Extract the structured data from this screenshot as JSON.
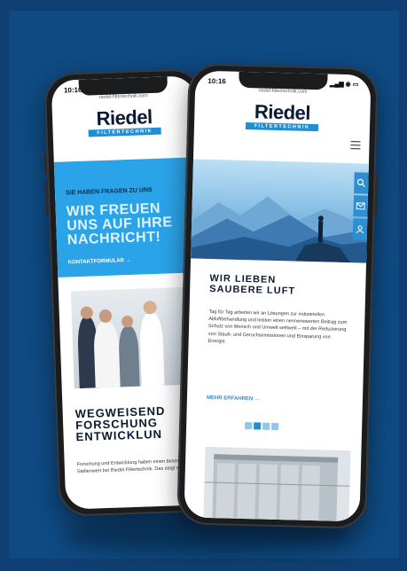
{
  "back_phone": {
    "time": "10:16",
    "url": "riedel-filtertechnik.com",
    "logo": {
      "word": "Riedel",
      "tagline": "FILTERTECHNIK"
    },
    "hero": {
      "kicker": "SIE HABEN FRAGEN ZU UNS",
      "headline_1": "WIR FREUEN",
      "headline_2": "UNS AUF IHRE",
      "headline_3": "NACHRICHT!",
      "link": "KONTAKTFORMULAR →"
    },
    "section_title_1": "WEGWEISEND",
    "section_title_2": "FORSCHUNG",
    "section_title_3": "ENTWICKLUN",
    "body_text": "Forschung und Entwicklung haben einen besonderen Stellenwert bei Riedel Filtertechnik. Das zeigt sich nicht"
  },
  "front_phone": {
    "time": "10:16",
    "url": "riedel-filtertechnik.com",
    "logo": {
      "word": "Riedel",
      "tagline": "FILTERTECHNIK"
    },
    "headline_1": "WIR LIEBEN",
    "headline_2": "SAUBERE LUFT",
    "body_text": "Tag für Tag arbeiten wir an Lösungen zur industriellen Abluftbehandlung und leisten einen nennenswerten Beitrag zum Schutz von Mensch und Umwelt weltweit – mit der Reduzierung von Staub- und Geruchsemissionen und Einsparung von Energie.",
    "link": "MEHR ERFAHREN →",
    "side_tabs": [
      "search-icon",
      "mail-icon",
      "contact-icon"
    ],
    "slider_dots": 4,
    "active_dot": 1
  },
  "colors": {
    "background": "#0f4a82",
    "accent": "#1e8fd6",
    "hero_blue": "#2ba3e8",
    "dark_text": "#0b1a33"
  }
}
